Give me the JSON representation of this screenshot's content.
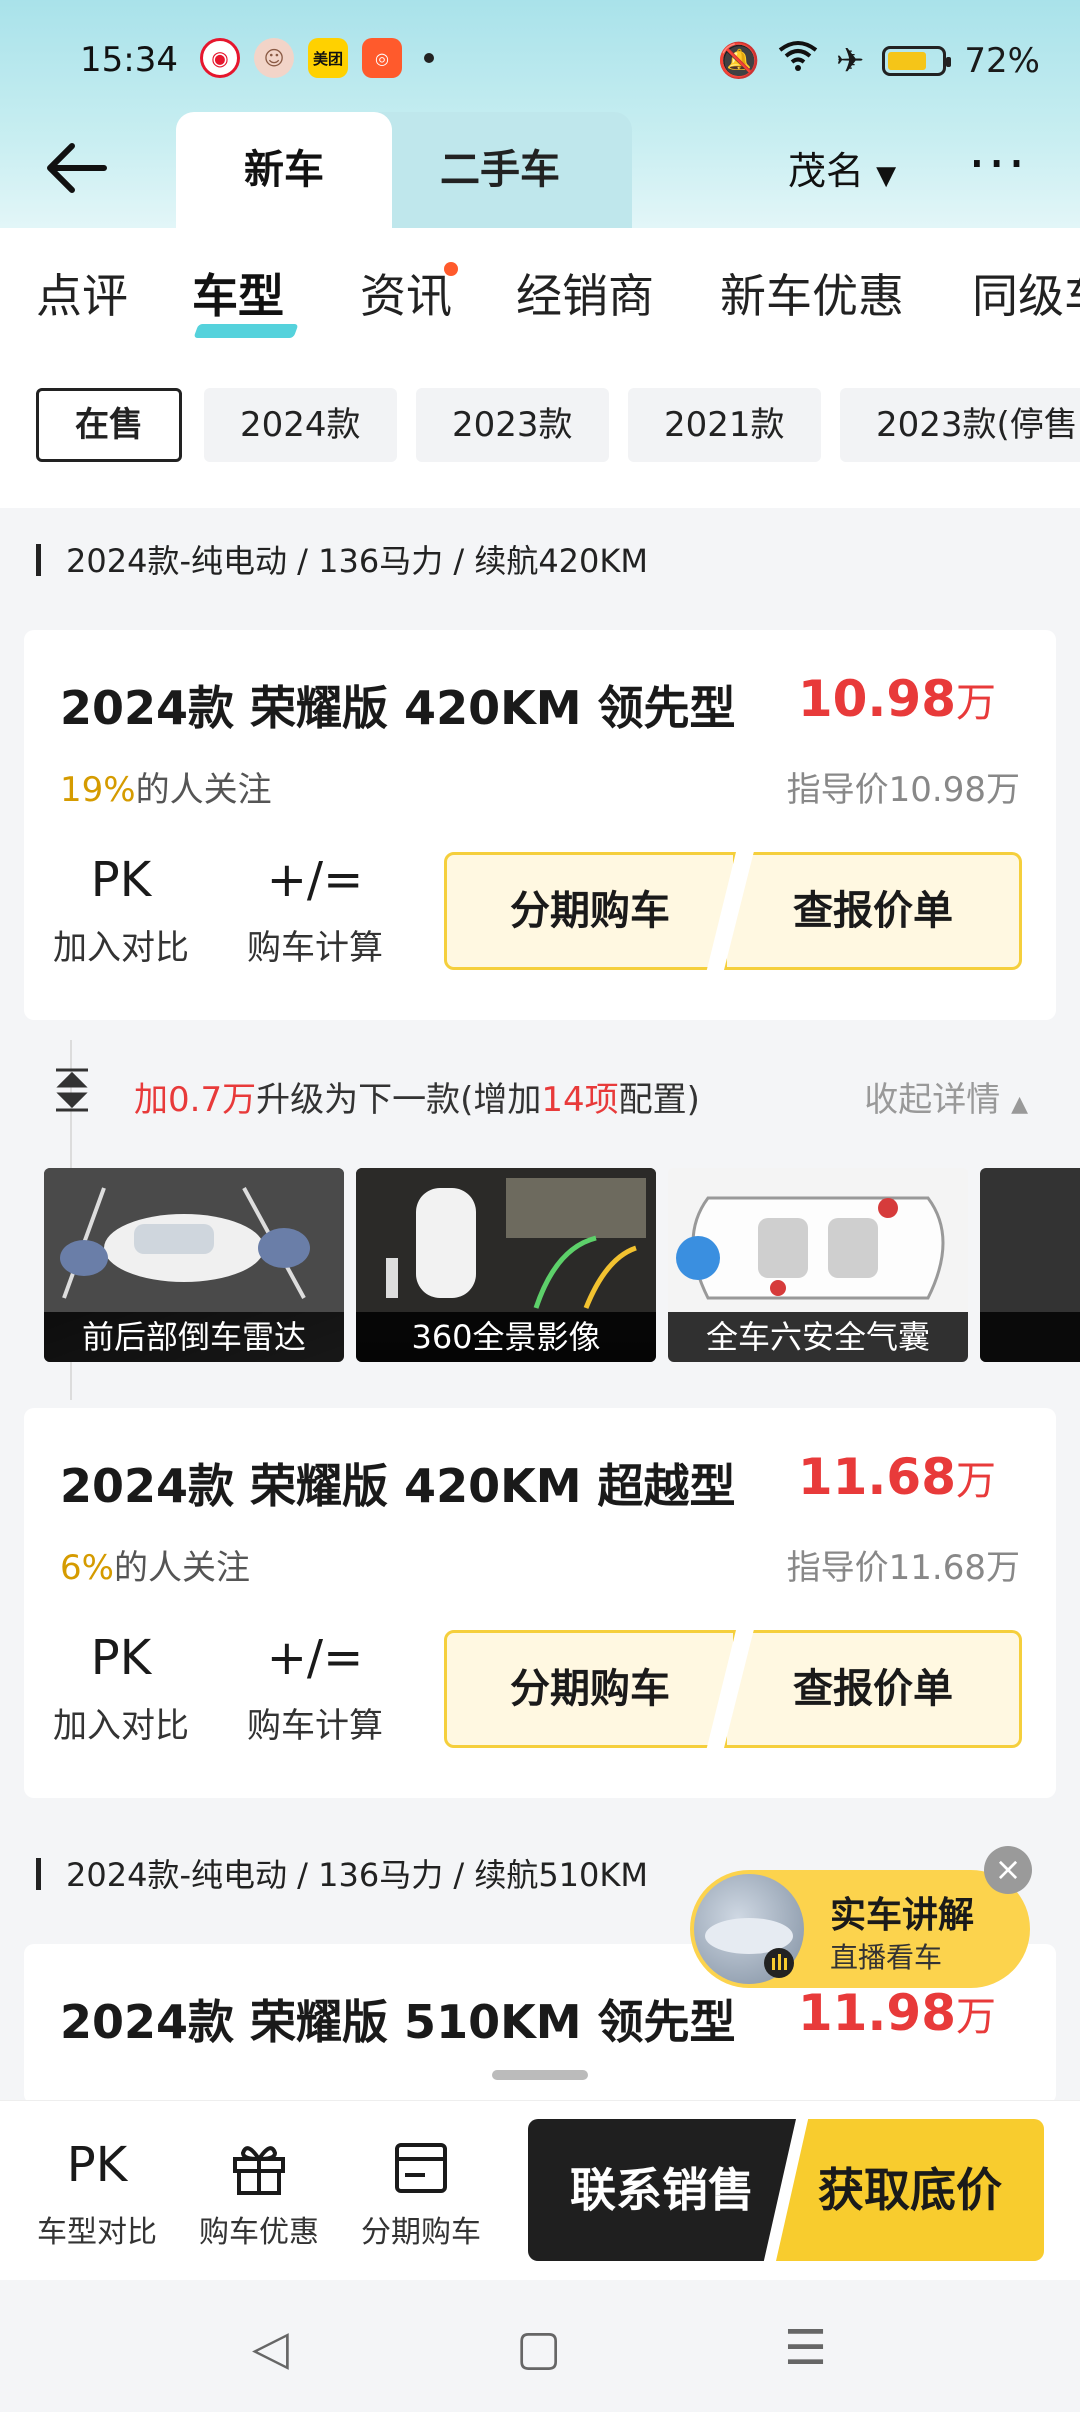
{
  "status_bar": {
    "time": "15:34",
    "apps": [
      "weibo-icon",
      "avatar-icon",
      "meituan-icon",
      "xiaohongshu-icon"
    ],
    "meituan_label": "美团",
    "battery": "72%",
    "battery_level": 0.72
  },
  "header": {
    "tabs": [
      {
        "label": "新车"
      },
      {
        "label": "二手车"
      }
    ],
    "city": "茂名",
    "more": "···"
  },
  "subnav": {
    "items": [
      {
        "label": "点评"
      },
      {
        "label": "车型"
      },
      {
        "label": "资讯"
      },
      {
        "label": "经销商"
      },
      {
        "label": "新车优惠"
      },
      {
        "label": "同级车"
      }
    ],
    "active": "车型"
  },
  "filters": [
    {
      "label": "在售"
    },
    {
      "label": "2024款"
    },
    {
      "label": "2023款"
    },
    {
      "label": "2021款"
    },
    {
      "label": "2023款(停售)"
    }
  ],
  "sections": [
    {
      "title": "2024款-纯电动 / 136马力 / 续航420KM"
    },
    {
      "title": "2024款-纯电动 / 136马力 / 续航510KM"
    }
  ],
  "cards": [
    {
      "name": "2024款 荣耀版 420KM 领先型",
      "price": "10.98",
      "unit": "万",
      "attention_pct": "19%",
      "attention_text": "的人关注",
      "guide": "指导价10.98万"
    },
    {
      "name": "2024款 荣耀版 420KM 超越型",
      "price": "11.68",
      "unit": "万",
      "attention_pct": "6%",
      "attention_text": "的人关注",
      "guide": "指导价11.68万"
    },
    {
      "name": "2024款 荣耀版 510KM 领先型",
      "price": "11.98",
      "unit": "万"
    }
  ],
  "card_actions": {
    "pk_icon": "PK",
    "pk_label": "加入对比",
    "calc_icon": "+/=",
    "calc_label": "购车计算",
    "installment": "分期购车",
    "quote": "查报价单"
  },
  "upgrade": {
    "prefix": "加0.7万",
    "mid": "升级为下一款(增加",
    "count": "14项",
    "suffix": "配置)",
    "collapse": "收起详情"
  },
  "thumbs": [
    {
      "caption": "前后部倒车雷达"
    },
    {
      "caption": "360全景影像"
    },
    {
      "caption": "全车六安全气囊"
    }
  ],
  "floating": {
    "title": "实车讲解",
    "subtitle": "直播看车",
    "close": "×"
  },
  "bottom_bar": {
    "items": [
      {
        "label": "车型对比",
        "icon": "PK"
      },
      {
        "label": "购车优惠",
        "icon": "gift-icon"
      },
      {
        "label": "分期购车",
        "icon": "installment-icon"
      }
    ],
    "contact": "联系销售",
    "get_price": "获取底价"
  },
  "colors": {
    "accent_red": "#e83a3a",
    "accent_yellow": "#f8cc2e",
    "teal": "#55d2dc"
  }
}
